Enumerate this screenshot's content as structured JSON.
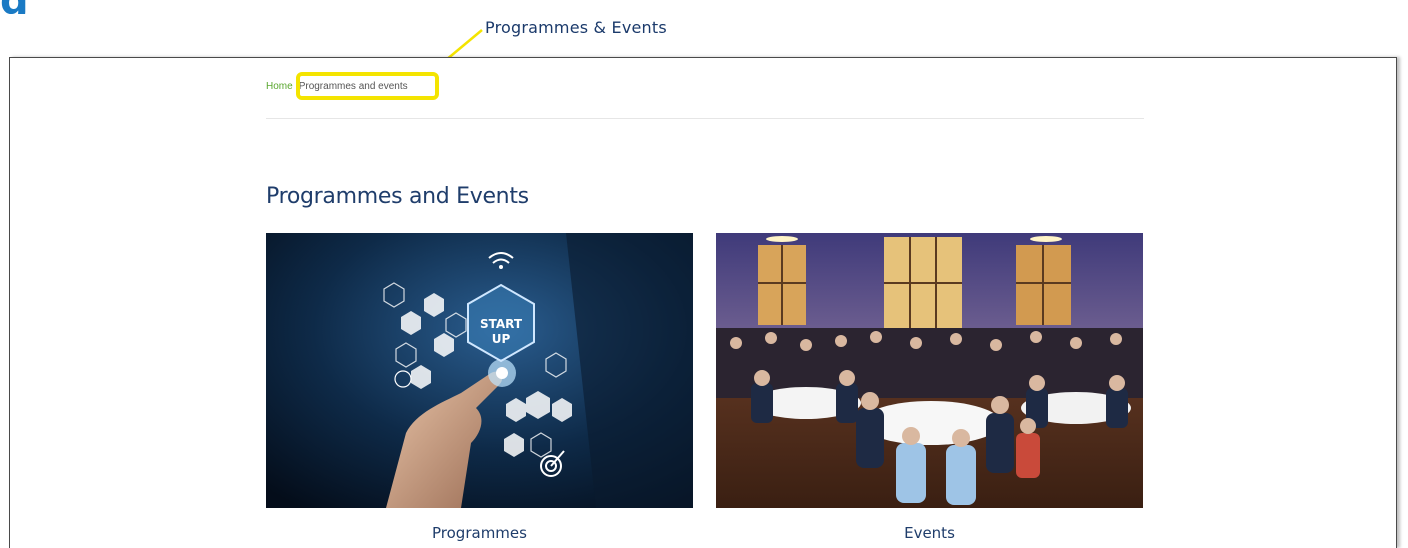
{
  "callout": {
    "label": "Programmes & Events",
    "highlight_color": "#f4e400"
  },
  "breadcrumb": {
    "home": "Home",
    "current": "Programmes and events"
  },
  "page": {
    "title": "Programmes and Events"
  },
  "cards": {
    "programmes": {
      "label": "Programmes",
      "image_overlay_text": "START UP",
      "image_icon": "startup-hexagon-network"
    },
    "events": {
      "label": "Events",
      "image_icon": "banquet-hall-photo"
    }
  },
  "colors": {
    "title": "#1f3d6b",
    "breadcrumb_home": "#5aa72f",
    "callout_text": "#1b3a6b"
  }
}
